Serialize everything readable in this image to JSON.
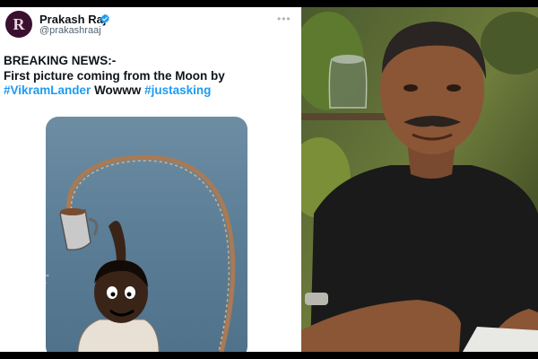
{
  "tweet": {
    "author_name": "Prakash Raj",
    "handle": "@prakashraaj",
    "avatar_letter": "R",
    "text_lines": [
      {
        "text": "BREAKING NEWS:-",
        "tag": false
      },
      {
        "text": "First picture coming from the Moon by",
        "tag": false
      }
    ],
    "hashtag_1": "#VikramLander",
    "middle_word": " Wowww ",
    "hashtag_2": "#justasking"
  },
  "colors": {
    "hashtag": "#1d9bf0",
    "verified_badge": "#1d9bf0",
    "avatar_bg": "#3a1030"
  },
  "icons": [
    "verified-badge-icon",
    "more-options-icon"
  ]
}
